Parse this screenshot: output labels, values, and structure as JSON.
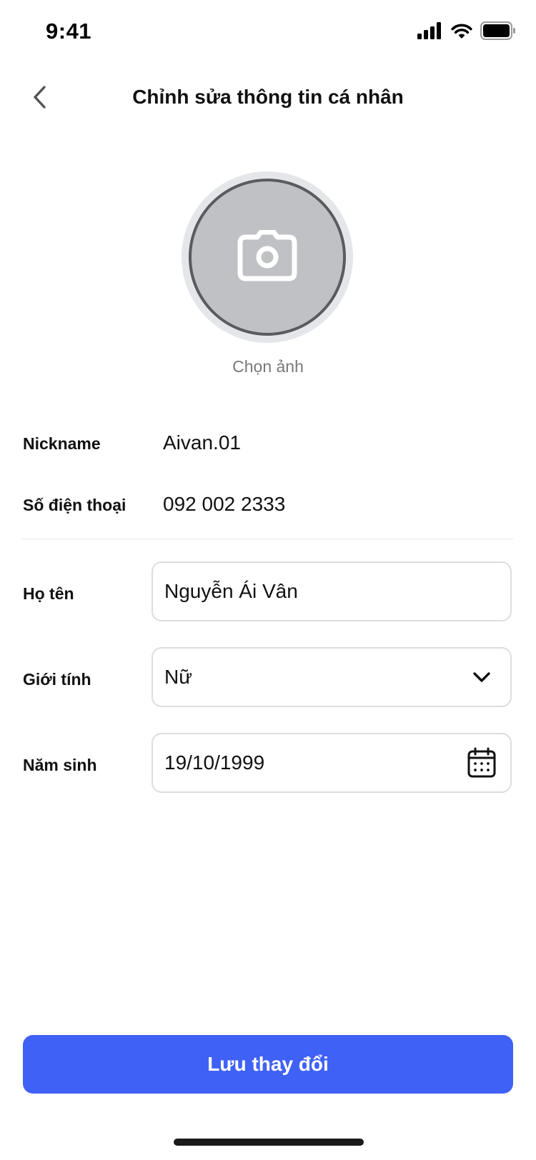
{
  "status_bar": {
    "time": "9:41"
  },
  "header": {
    "title": "Chỉnh sửa thông tin cá nhân"
  },
  "avatar": {
    "caption": "Chọn ảnh"
  },
  "profile": {
    "nickname": {
      "label": "Nickname",
      "value": "Aivan.01"
    },
    "phone": {
      "label": "Số điện thoại",
      "value": "092 002 2333"
    },
    "full_name": {
      "label": "Họ tên",
      "value": "Nguyễn Ái Vân"
    },
    "gender": {
      "label": "Giới tính",
      "value": "Nữ"
    },
    "birth_date": {
      "label": "Năm sinh",
      "value": "19/10/1999"
    }
  },
  "actions": {
    "save_label": "Lưu thay đổi"
  },
  "icons": {
    "back": "chevron-left-icon",
    "camera": "camera-icon",
    "gender_dropdown": "chevron-down-icon",
    "calendar": "calendar-icon"
  },
  "colors": {
    "primary": "#4061f5",
    "avatar_fill": "#c0c1c4",
    "field_border": "#dcdde0"
  }
}
